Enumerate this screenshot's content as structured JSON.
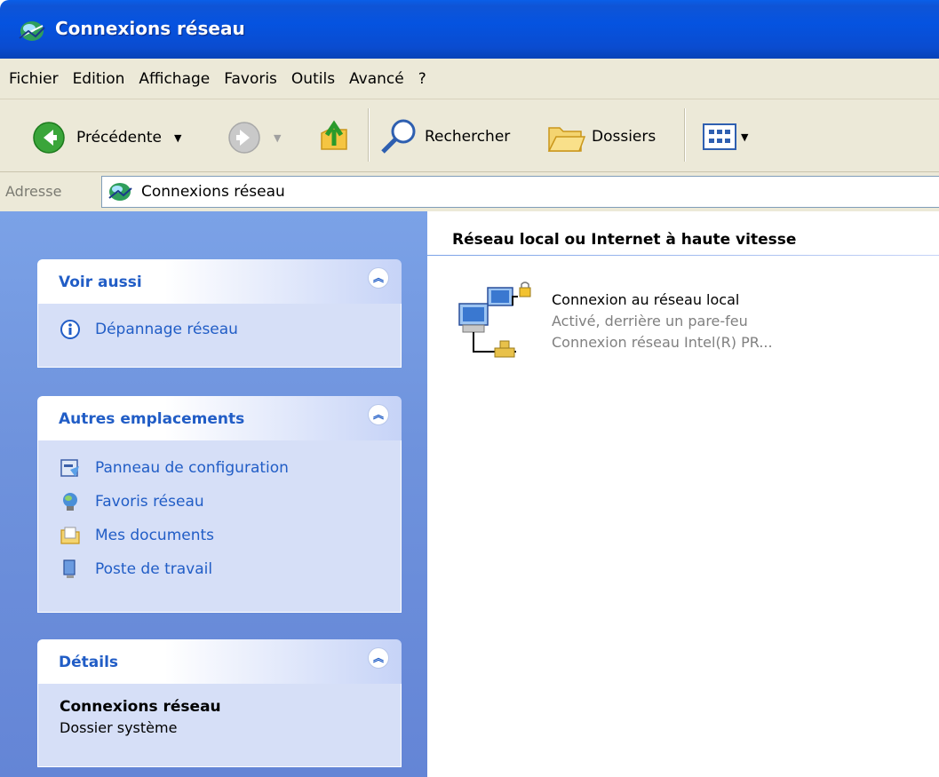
{
  "window": {
    "title": "Connexions réseau"
  },
  "menu": {
    "items": [
      "Fichier",
      "Edition",
      "Affichage",
      "Favoris",
      "Outils",
      "Avancé",
      "?"
    ]
  },
  "toolbar": {
    "back_label": "Précédente",
    "search_label": "Rechercher",
    "folders_label": "Dossiers"
  },
  "address": {
    "label": "Adresse",
    "value": "Connexions réseau"
  },
  "taskpane": {
    "see_also": {
      "title": "Voir aussi",
      "links": [
        {
          "label": "Dépannage réseau",
          "icon": "info-icon"
        }
      ]
    },
    "other_places": {
      "title": "Autres emplacements",
      "links": [
        {
          "label": "Panneau de configuration",
          "icon": "control-panel-icon"
        },
        {
          "label": "Favoris réseau",
          "icon": "network-places-icon"
        },
        {
          "label": "Mes documents",
          "icon": "my-documents-icon"
        },
        {
          "label": "Poste de travail",
          "icon": "my-computer-icon"
        }
      ]
    },
    "details": {
      "title": "Détails",
      "name": "Connexions réseau",
      "type": "Dossier système"
    }
  },
  "main": {
    "group_title": "Réseau local ou Internet à haute vitesse",
    "connection": {
      "name": "Connexion au réseau local",
      "status": "Activé, derrière un pare-feu",
      "device": "Connexion réseau Intel(R) PR..."
    }
  },
  "colors": {
    "titlebar": "#0553e0",
    "taskpane_bg": "#6f93dd",
    "link": "#215dc6",
    "chrome": "#ece9d8"
  }
}
